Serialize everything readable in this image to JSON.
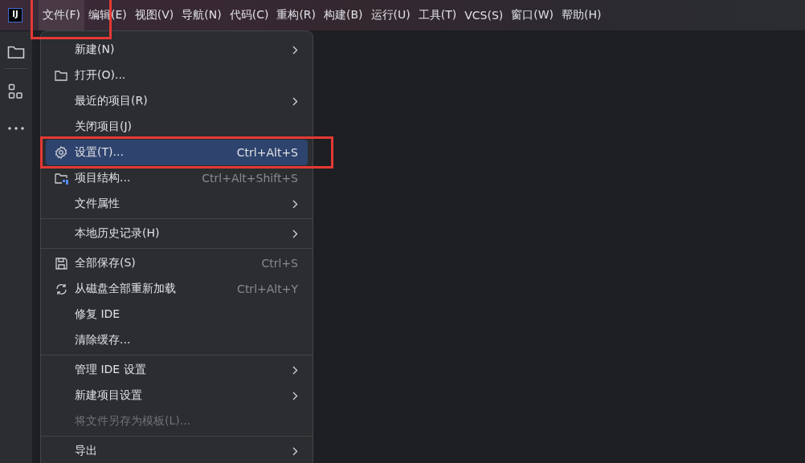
{
  "logo": {
    "text": "IJ"
  },
  "menu_bar": [
    {
      "label": "文件(F)",
      "selected": true,
      "highlighted": true
    },
    {
      "label": "编辑(E)",
      "selected": false,
      "highlighted": false
    },
    {
      "label": "视图(V)",
      "selected": false,
      "highlighted": false
    },
    {
      "label": "导航(N)",
      "selected": false,
      "highlighted": false
    },
    {
      "label": "代码(C)",
      "selected": false,
      "highlighted": false
    },
    {
      "label": "重构(R)",
      "selected": false,
      "highlighted": false
    },
    {
      "label": "构建(B)",
      "selected": false,
      "highlighted": false
    },
    {
      "label": "运行(U)",
      "selected": false,
      "highlighted": false
    },
    {
      "label": "工具(T)",
      "selected": false,
      "highlighted": false
    },
    {
      "label": "VCS(S)",
      "selected": false,
      "highlighted": false
    },
    {
      "label": "窗口(W)",
      "selected": false,
      "highlighted": false
    },
    {
      "label": "帮助(H)",
      "selected": false,
      "highlighted": false
    }
  ],
  "sidebar": {
    "items": [
      {
        "kind": "folder"
      },
      {
        "kind": "structure"
      },
      {
        "kind": "more"
      }
    ]
  },
  "file_menu": {
    "groups": [
      [
        {
          "label": "新建(N)",
          "kind": "plain",
          "submenu": true,
          "selected": false,
          "disabled": false,
          "highlighted": false
        },
        {
          "label": "打开(O)...",
          "kind": "open",
          "submenu": false,
          "selected": false,
          "disabled": false,
          "highlighted": false
        },
        {
          "label": "最近的项目(R)",
          "kind": "plain",
          "submenu": true,
          "selected": false,
          "disabled": false,
          "highlighted": false
        },
        {
          "label": "关闭项目(J)",
          "kind": "plain",
          "submenu": false,
          "selected": false,
          "disabled": false,
          "highlighted": false
        },
        {
          "label": "设置(T)...",
          "kind": "settings",
          "shortcut": "Ctrl+Alt+S",
          "submenu": false,
          "selected": true,
          "disabled": false,
          "highlighted": true
        },
        {
          "label": "项目结构...",
          "kind": "structure",
          "shortcut": "Ctrl+Alt+Shift+S",
          "submenu": false,
          "selected": false,
          "disabled": false,
          "highlighted": false
        },
        {
          "label": "文件属性",
          "kind": "plain",
          "submenu": true,
          "selected": false,
          "disabled": false,
          "highlighted": false
        }
      ],
      [
        {
          "label": "本地历史记录(H)",
          "kind": "plain",
          "submenu": true,
          "selected": false,
          "disabled": false,
          "highlighted": false
        }
      ],
      [
        {
          "label": "全部保存(S)",
          "kind": "save",
          "shortcut": "Ctrl+S",
          "submenu": false,
          "selected": false,
          "disabled": false,
          "highlighted": false
        },
        {
          "label": "从磁盘全部重新加载",
          "kind": "reload",
          "shortcut": "Ctrl+Alt+Y",
          "submenu": false,
          "selected": false,
          "disabled": false,
          "highlighted": false
        },
        {
          "label": "修复 IDE",
          "kind": "plain",
          "submenu": false,
          "selected": false,
          "disabled": false,
          "highlighted": false
        },
        {
          "label": "清除缓存...",
          "kind": "plain",
          "submenu": false,
          "selected": false,
          "disabled": false,
          "highlighted": false
        }
      ],
      [
        {
          "label": "管理 IDE 设置",
          "kind": "plain",
          "submenu": true,
          "selected": false,
          "disabled": false,
          "highlighted": false
        },
        {
          "label": "新建项目设置",
          "kind": "plain",
          "submenu": true,
          "selected": false,
          "disabled": false,
          "highlighted": false
        },
        {
          "label": "将文件另存为模板(L)...",
          "kind": "plain",
          "submenu": false,
          "selected": false,
          "disabled": true,
          "highlighted": false
        }
      ],
      [
        {
          "label": "导出",
          "kind": "plain",
          "submenu": true,
          "selected": false,
          "disabled": false,
          "highlighted": false
        }
      ]
    ]
  }
}
